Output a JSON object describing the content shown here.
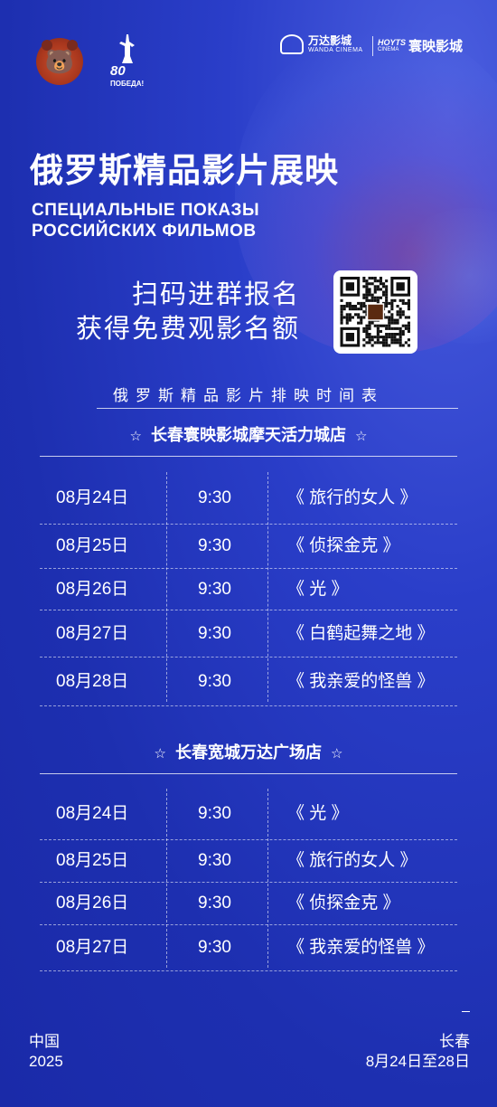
{
  "colors": {
    "background": "#1f32b3",
    "text": "#ffffff"
  },
  "logos": {
    "bear_icon": "cartoon-bear-mascot-icon",
    "victory": {
      "number": "80",
      "text": "ПОБЕДА!"
    },
    "wanda": {
      "cn": "万达影城",
      "en": "WANDA CINEMA"
    },
    "hoyts": {
      "en": "HOYTS",
      "sub": "CINEMA",
      "cn": "寰映影城"
    }
  },
  "title_cn": "俄罗斯精品影片展映",
  "title_ru": [
    "СПЕЦИАЛЬНЫЕ ПОКАЗЫ",
    "РОССИЙСКИХ ФИЛЬМОВ"
  ],
  "scan_text": [
    "扫码进群报名",
    "获得免费观影名额"
  ],
  "schedule_title": "俄罗斯精品影片排映时间表",
  "cinemas": [
    {
      "name": "长春寰映影城摩天活力城店",
      "screenings": [
        {
          "date": "08月24日",
          "time": "9:30",
          "film": "《 旅行的女人 》"
        },
        {
          "date": "08月25日",
          "time": "9:30",
          "film": "《 侦探金克 》"
        },
        {
          "date": "08月26日",
          "time": "9:30",
          "film": "《 光 》"
        },
        {
          "date": "08月27日",
          "time": "9:30",
          "film": "《 白鹤起舞之地 》"
        },
        {
          "date": "08月28日",
          "time": "9:30",
          "film": "《 我亲爱的怪兽 》"
        }
      ]
    },
    {
      "name": "长春宽城万达广场店",
      "screenings": [
        {
          "date": "08月24日",
          "time": "9:30",
          "film": "《 光 》"
        },
        {
          "date": "08月25日",
          "time": "9:30",
          "film": "《 旅行的女人 》"
        },
        {
          "date": "08月26日",
          "time": "9:30",
          "film": "《 侦探金克 》"
        },
        {
          "date": "08月27日",
          "time": "9:30",
          "film": "《 我亲爱的怪兽 》"
        }
      ]
    }
  ],
  "footer": {
    "left": [
      "中国",
      "2025"
    ],
    "right": [
      "长春",
      "8月24日至28日"
    ]
  }
}
